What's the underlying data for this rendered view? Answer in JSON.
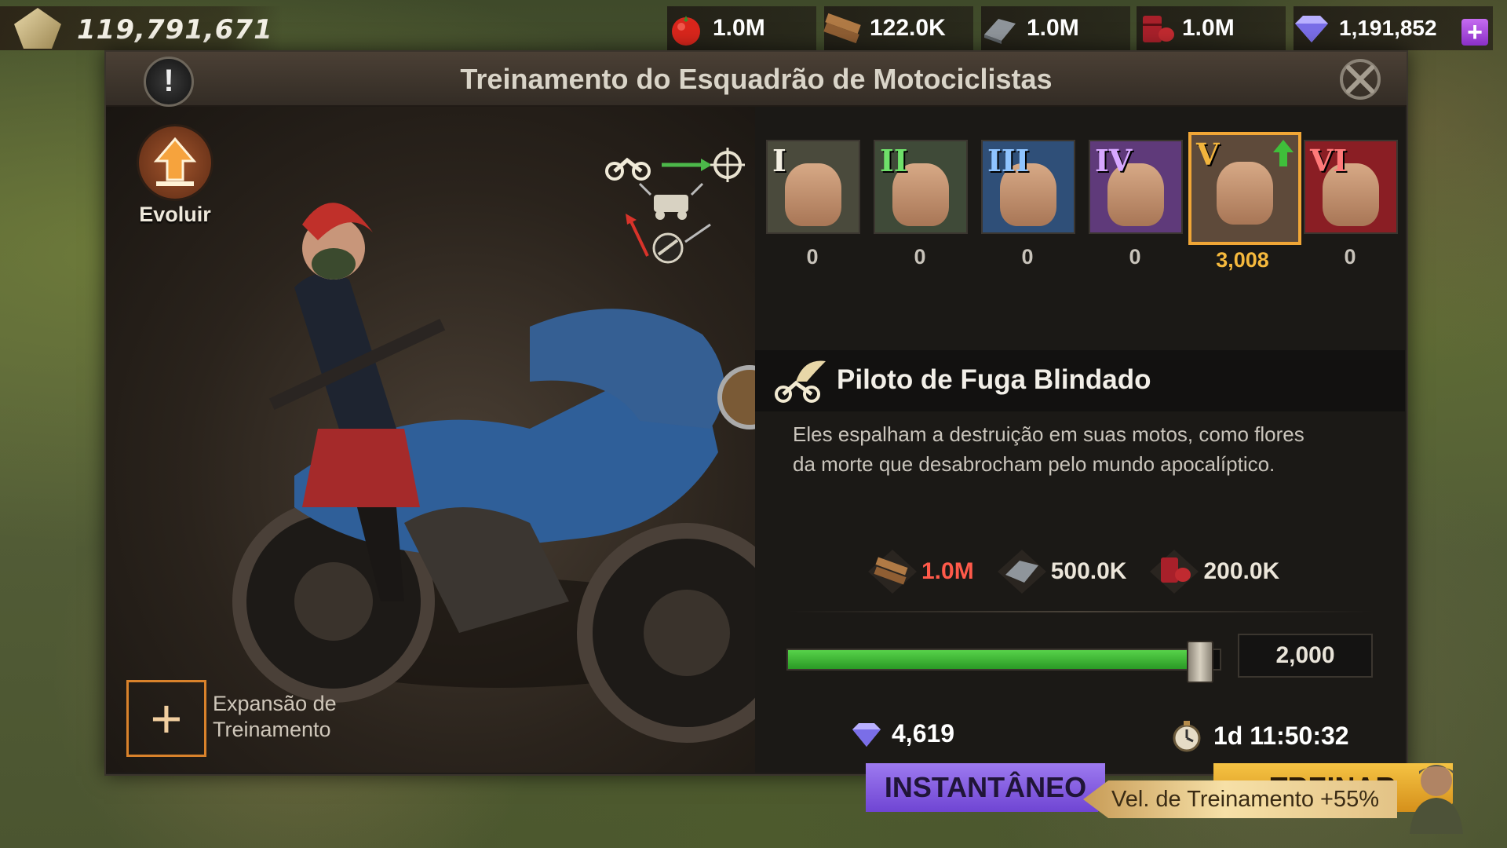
{
  "top_bar": {
    "power": "119,791,671",
    "resources": [
      {
        "icon": "tomato-food-icon",
        "value": "1.0M"
      },
      {
        "icon": "wood-planks-icon",
        "value": "122.0K"
      },
      {
        "icon": "steel-ingot-icon",
        "value": "1.0M"
      },
      {
        "icon": "oil-barrel-icon",
        "value": "1.0M"
      },
      {
        "icon": "diamond-gem-icon",
        "value": "1,191,852"
      }
    ],
    "add_label": "+"
  },
  "panel": {
    "title": "Treinamento do Esquadrão de Motociclistas",
    "info_label": "!",
    "evolve_label": "Evoluir",
    "expansion_label_line1": "Expansão de",
    "expansion_label_line2": "Treinamento",
    "expansion_plus": "+"
  },
  "tiers": [
    {
      "roman": "I",
      "count": "0",
      "selected": false,
      "bg": "#4a4a3c"
    },
    {
      "roman": "II",
      "count": "0",
      "selected": false,
      "bg": "#3f4a38"
    },
    {
      "roman": "III",
      "count": "0",
      "selected": false,
      "bg": "#2f4f78"
    },
    {
      "roman": "IV",
      "count": "0",
      "selected": false,
      "bg": "#5f3a7a"
    },
    {
      "roman": "V",
      "count": "3,008",
      "selected": true,
      "bg": "#5e4a3a"
    },
    {
      "roman": "VI",
      "count": "0",
      "selected": false,
      "bg": "#8a1e24"
    }
  ],
  "unit": {
    "name": "Piloto de Fuga Blindado",
    "description_line1": "Eles espalham a destruição em suas motos, como flores",
    "description_line2": "da morte que desabrocham pelo mundo apocalíptico."
  },
  "costs": [
    {
      "icon": "wood-planks-icon",
      "value": "1.0M",
      "color": "#ff5a4a"
    },
    {
      "icon": "steel-ingot-icon",
      "value": "500.0K",
      "color": "#ece6da"
    },
    {
      "icon": "oil-barrel-icon",
      "value": "200.0K",
      "color": "#ece6da"
    }
  ],
  "training": {
    "quantity": "2,000",
    "slider_fraction": 0.95,
    "gem_cost": "4,619",
    "time": "1d 11:50:32",
    "instant_label": "INSTANTÂNEO",
    "train_label": "TREINAR",
    "speed_label": "Vel. de Treinamento +55%"
  },
  "colors": {
    "accent_gold": "#f1a636",
    "slider_green": "#3cb335",
    "instant_purple": "#8a63e6",
    "train_gold": "#e8ad2e"
  }
}
